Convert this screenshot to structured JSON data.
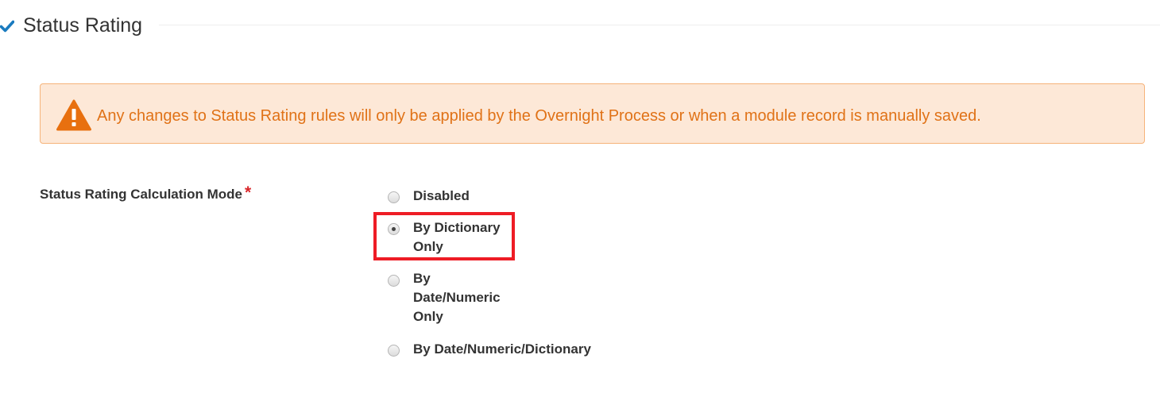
{
  "section": {
    "title": "Status Rating",
    "expanded_icon": "check-icon"
  },
  "warning": {
    "icon": "warning-triangle-icon",
    "message": "Any changes to Status Rating rules will only be applied by the Overnight Process or when a module record is manually saved."
  },
  "calculation_mode": {
    "label": "Status Rating Calculation Mode",
    "required_marker": "*",
    "selected": "By Dictionary Only",
    "options": [
      {
        "label": "Disabled",
        "selected": false
      },
      {
        "label": "By Dictionary Only",
        "selected": true
      },
      {
        "label": "By Date/Numeric Only",
        "selected": false
      },
      {
        "label": "By Date/Numeric/Dictionary",
        "selected": false
      }
    ]
  },
  "colors": {
    "accent_blue": "#1a7bbf",
    "warning_text": "#e07217",
    "warning_bg": "#fde8d7",
    "warning_border": "#f6b37a",
    "required_red": "#d9262a",
    "highlight_red": "#ee1c25"
  }
}
